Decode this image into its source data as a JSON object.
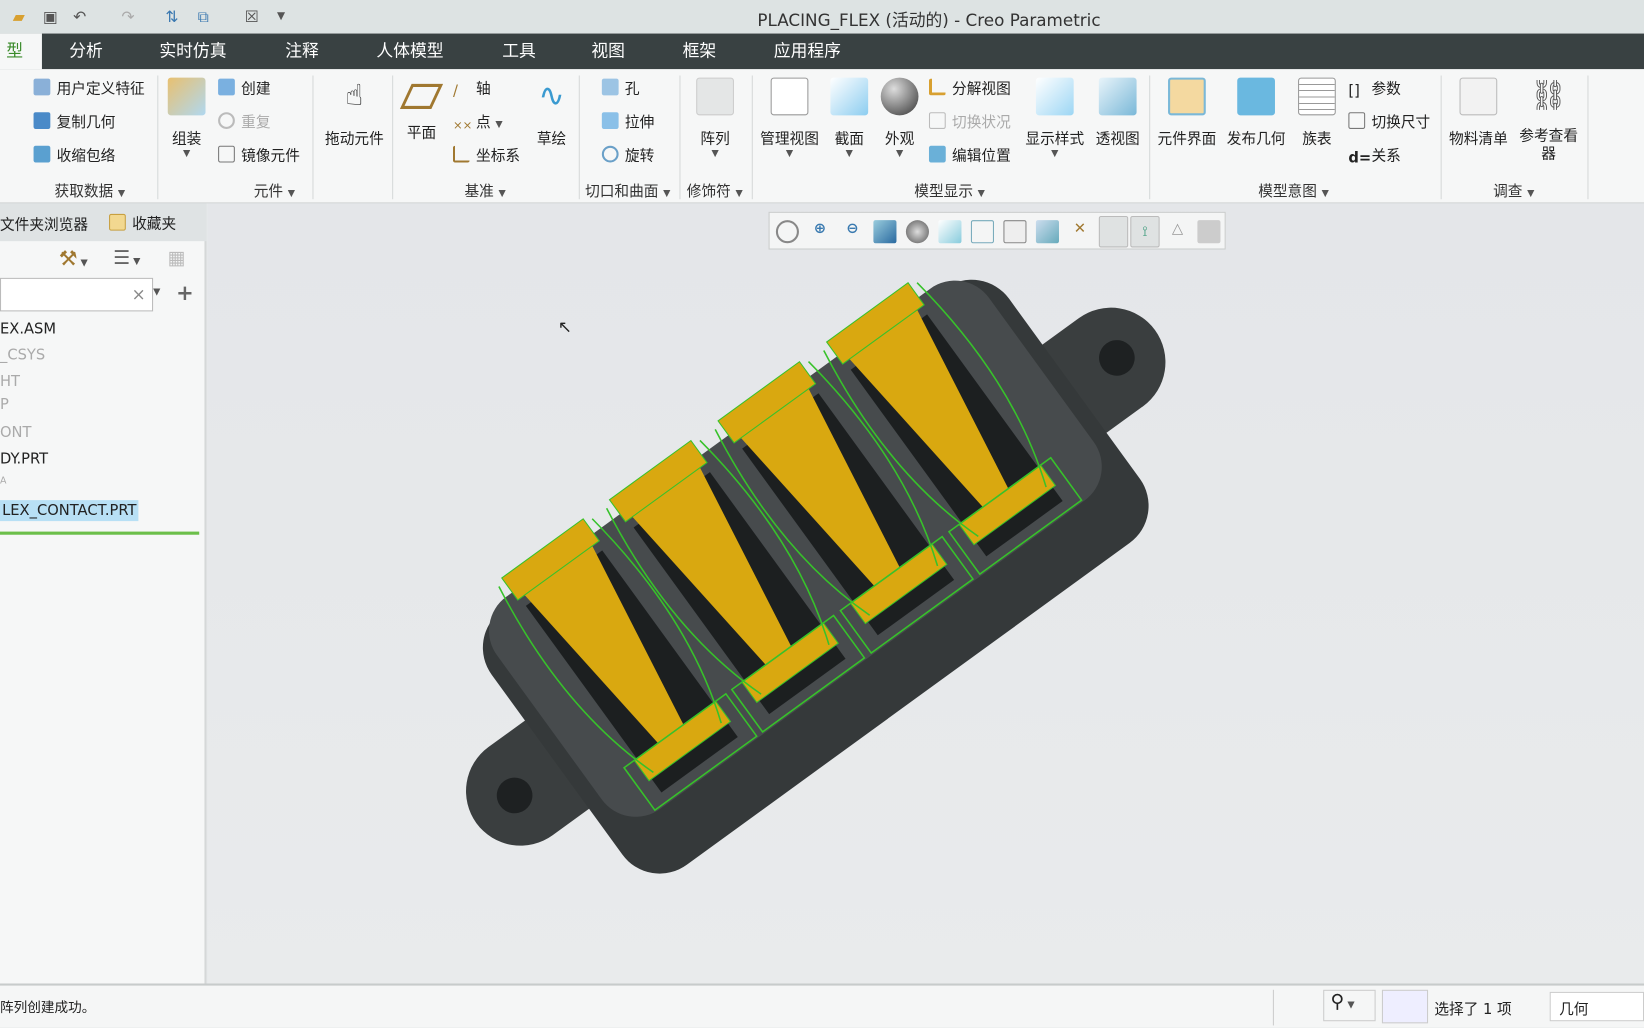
{
  "window": {
    "title": "PLACING_FLEX (活动的) - Creo Parametric"
  },
  "quick_access": [
    "open-icon",
    "save-icon",
    "undo-icon",
    "redo-icon",
    "regenerate-icon",
    "windows-icon",
    "close-window-icon",
    "customize-icon"
  ],
  "tabs": [
    {
      "label": "型",
      "active": true
    },
    {
      "label": "分析"
    },
    {
      "label": "实时仿真"
    },
    {
      "label": "注释"
    },
    {
      "label": "人体模型"
    },
    {
      "label": "工具"
    },
    {
      "label": "视图"
    },
    {
      "label": "框架"
    },
    {
      "label": "应用程序"
    }
  ],
  "ribbon": {
    "get_data": {
      "label": "获取数据",
      "items": [
        "用户定义特征",
        "复制几何",
        "收缩包络"
      ]
    },
    "component": {
      "label": "元件",
      "assemble": "组装",
      "create": "创建",
      "repeat": "重复",
      "mirror": "镜像元件",
      "drag": "拖动元件"
    },
    "datum": {
      "label": "基准",
      "plane": "平面",
      "axis": "轴",
      "point": "点",
      "csys": "坐标系",
      "sketch": "草绘"
    },
    "cut_surface": {
      "label": "切口和曲面",
      "items": [
        "孔",
        "拉伸",
        "旋转"
      ]
    },
    "modifiers": {
      "label": "修饰符",
      "pattern": "阵列"
    },
    "model_display": {
      "label": "模型显示",
      "manage_views": "管理视图",
      "section": "截面",
      "appearance": "外观",
      "explode": "分解视图",
      "toggle_status": "切换状况",
      "edit_position": "编辑位置",
      "display_style": "显示样式",
      "perspective": "透视图"
    },
    "model_intent": {
      "label": "模型意图",
      "component_interface": "元件界面",
      "publish_geometry": "发布几何",
      "family_table": "族表",
      "parameters": "参数",
      "switch_dimensions": "切换尺寸",
      "relations": "关系"
    },
    "investigate": {
      "label": "调查",
      "bom": "物料清单",
      "reference_viewer": "参考查看器"
    }
  },
  "left_panel": {
    "tabs": [
      "文件夹浏览器",
      "收藏夹"
    ],
    "search": {
      "value": "",
      "clear": "×"
    },
    "tree": [
      {
        "label": "EX.ASM"
      },
      {
        "label": "_CSYS",
        "dim": true
      },
      {
        "label": "HT",
        "dim": true
      },
      {
        "label": "P",
        "dim": true
      },
      {
        "label": "ONT",
        "dim": true
      },
      {
        "label": "DY.PRT"
      },
      {
        "label": "A",
        "dim": true
      },
      {
        "label": "LEX_CONTACT.PRT",
        "selected": true
      }
    ]
  },
  "viewport_toolbar": [
    "refit-icon",
    "zoom-in-icon",
    "zoom-out-icon",
    "repaint-icon",
    "shading-icon",
    "saved-views-icon",
    "view-manager-icon",
    "camera-icon",
    "display-style-icon",
    "datum-display-icon",
    "annotation-display-icon",
    "spin-center-icon",
    "triangle-icon",
    "hide-icon"
  ],
  "colors": {
    "tab_bar": "#394142",
    "accent_green": "#3a8a2a",
    "selection": "#b8e0f5",
    "model_body": "#3f4344",
    "contact": "#d9a810",
    "wireframe": "#37c22a"
  },
  "status": {
    "message": "阵列创建成功。",
    "selection": "选择了 1 项",
    "filter": "几何"
  }
}
